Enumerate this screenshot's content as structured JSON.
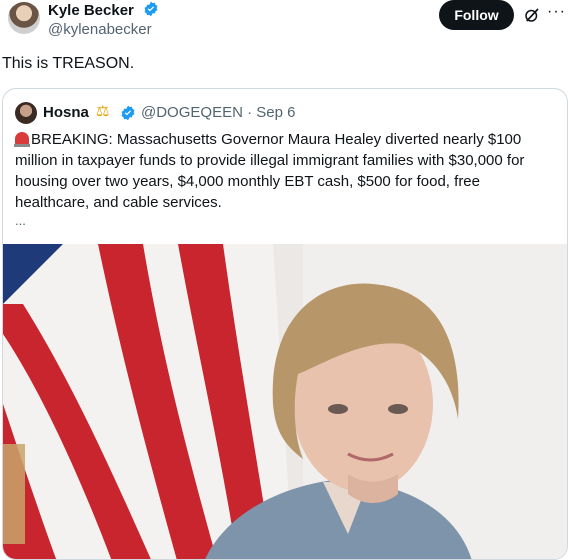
{
  "tweet": {
    "author_name": "Kyle Becker",
    "author_handle": "@kylenabecker",
    "follow_label": "Follow",
    "more_label": "···",
    "text": "This is TREASON."
  },
  "quoted": {
    "author_name": "Hosna",
    "handle_and_date": "@DOGEQEEN · Sep 6",
    "text": "BREAKING: Massachusetts Governor Maura Healey diverted nearly $100 million in taxpayer funds to provide illegal immigrant families with $30,000 for housing over two years, $4,000 monthly EBT cash, $500 for food, free healthcare, and cable services.",
    "ellipsis": "..."
  },
  "colors": {
    "verified_blue": "#1d9bf0",
    "text_primary": "#0f1419",
    "text_secondary": "#536471",
    "border": "#cfd9de",
    "follow_bg": "#0f1419",
    "flag_red": "#c8252e",
    "flag_blue": "#1f3a78"
  },
  "icons": {
    "verified": "verified-badge-icon",
    "grok": "grok-icon",
    "more": "more-icon",
    "scale": "balance-scale-icon",
    "siren": "siren-icon"
  }
}
